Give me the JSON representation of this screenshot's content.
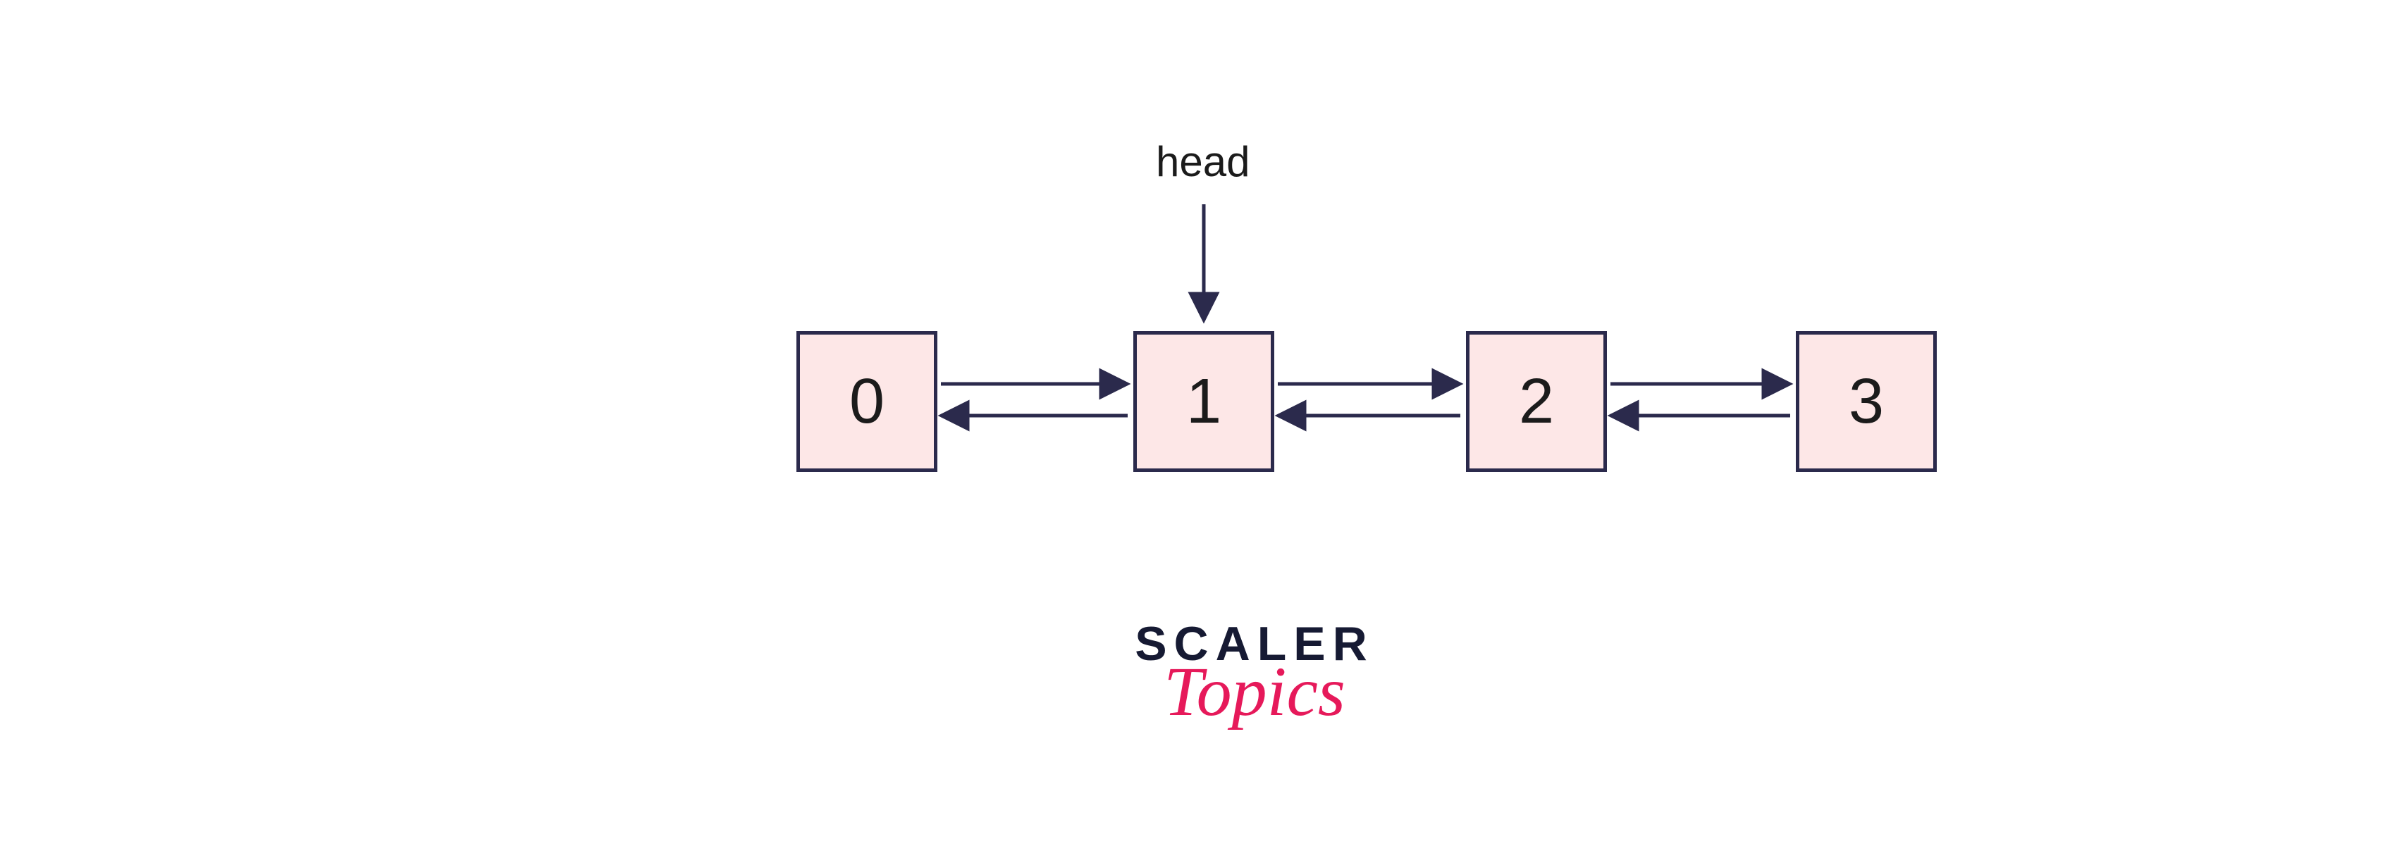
{
  "diagram": {
    "head_label": "head",
    "head_target_index": 1,
    "nodes": [
      {
        "value": "0"
      },
      {
        "value": "1"
      },
      {
        "value": "2"
      },
      {
        "value": "3"
      }
    ],
    "links": [
      {
        "from": 0,
        "to": 1,
        "bidirectional": true
      },
      {
        "from": 1,
        "to": 2,
        "bidirectional": true
      },
      {
        "from": 2,
        "to": 3,
        "bidirectional": true
      }
    ]
  },
  "branding": {
    "line1": "SCALER",
    "line2": "Topics",
    "colors": {
      "scaler": "#161a33",
      "topics": "#e6195a",
      "node_fill": "#fde7e7",
      "node_border": "#2b2a4c"
    }
  }
}
